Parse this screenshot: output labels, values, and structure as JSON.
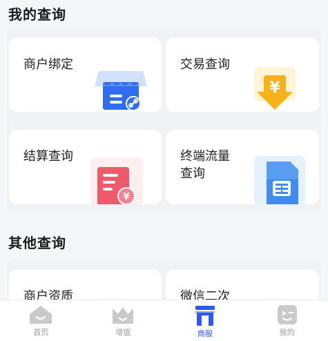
{
  "sections": {
    "my_queries": {
      "title": "我的查询",
      "cards": [
        {
          "label": "商户绑定",
          "icon": "store-link-icon"
        },
        {
          "label": "交易查询",
          "icon": "yen-download-icon"
        },
        {
          "label": "结算查询",
          "icon": "settlement-document-icon"
        },
        {
          "label": "终端流量\n查询",
          "icon": "sim-card-icon"
        }
      ]
    },
    "other_queries": {
      "title": "其他查询",
      "cards": [
        {
          "label": "商户资质",
          "icon": "merchant-qualification-icon"
        },
        {
          "label": "微信二次",
          "icon": "wechat-icon"
        }
      ]
    }
  },
  "tabbar": {
    "items": [
      {
        "label": "首页",
        "icon": "home-icon",
        "active": false
      },
      {
        "label": "增值",
        "icon": "crown-icon",
        "active": false
      },
      {
        "label": "商服",
        "icon": "shop-service-icon",
        "active": true
      },
      {
        "label": "我的",
        "icon": "profile-face-icon",
        "active": false
      }
    ]
  },
  "colors": {
    "accent": "#2f5bea",
    "inactive_tab": "#9a9a9a",
    "page_bg": "#f4f6fa"
  }
}
